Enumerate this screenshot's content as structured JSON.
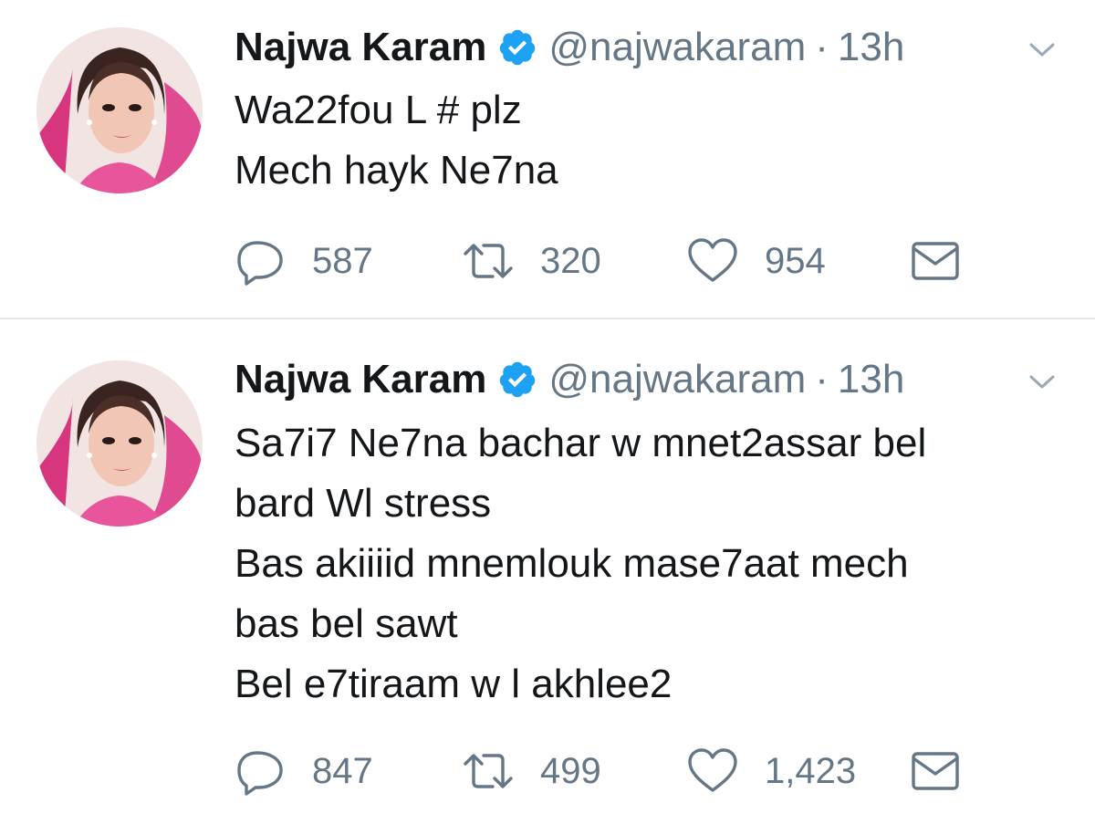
{
  "tweets": [
    {
      "author": {
        "name": "Najwa Karam",
        "handle": "@najwakaram",
        "verified": true,
        "avatar": "profile-photo"
      },
      "time": "13h",
      "separator": "·",
      "lines": [
        "Wa22fou L # plz",
        "Mech hayk Ne7na"
      ],
      "stats": {
        "replies": "587",
        "retweets": "320",
        "likes": "954"
      },
      "icons": [
        "reply-icon",
        "retweet-icon",
        "heart-icon",
        "mail-icon"
      ]
    },
    {
      "author": {
        "name": "Najwa Karam",
        "handle": "@najwakaram",
        "verified": true,
        "avatar": "profile-photo"
      },
      "time": "13h",
      "separator": "·",
      "lines": [
        "Sa7i7 Ne7na bachar w mnet2assar bel",
        "bard Wl stress",
        "Bas akiiiid mnemlouk mase7aat mech",
        "bas bel sawt",
        "Bel e7tiraam w l akhlee2"
      ],
      "stats": {
        "replies": "847",
        "retweets": "499",
        "likes": "1,423"
      },
      "icons": [
        "reply-icon",
        "retweet-icon",
        "heart-icon",
        "mail-icon"
      ]
    }
  ],
  "colors": {
    "text": "#14171a",
    "secondary": "#657786",
    "verified": "#1da1f2",
    "divider": "#e1e8ed"
  }
}
